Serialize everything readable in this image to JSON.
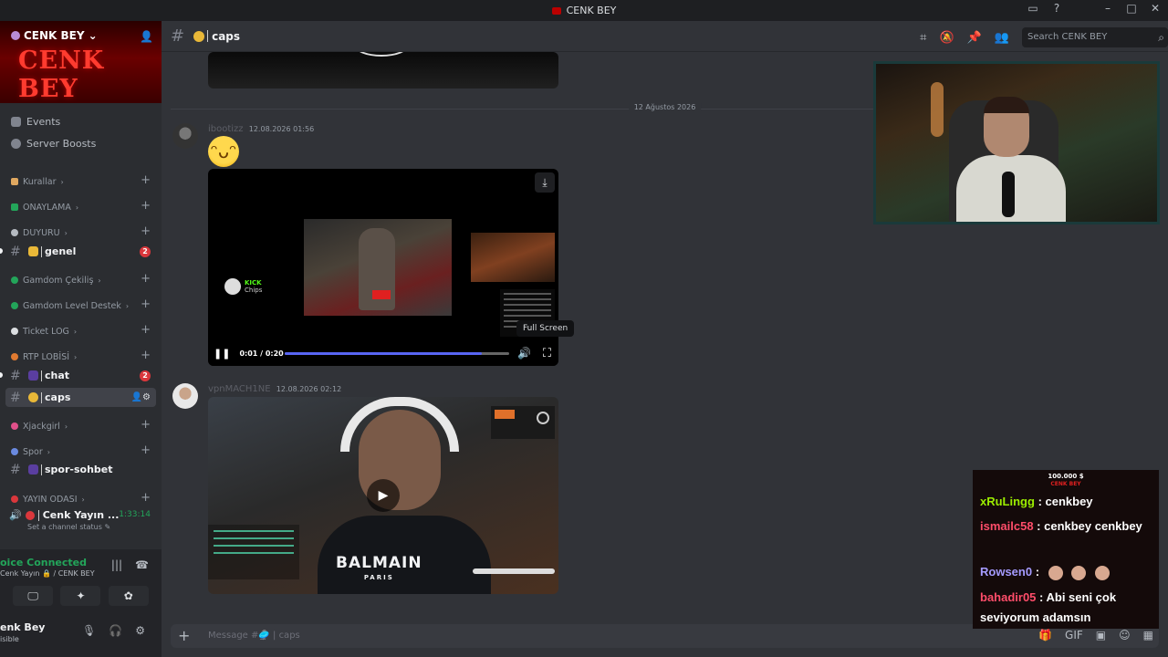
{
  "window": {
    "title": "CENK BEY"
  },
  "server": {
    "name": "CENK BEY",
    "banner_text": "CENK BEY",
    "nav": [
      {
        "label": "Events"
      },
      {
        "label": "Server Boosts"
      }
    ]
  },
  "categories": [
    {
      "label": "Kurallar"
    },
    {
      "label": "ONAYLAMA"
    },
    {
      "label": "DUYURU"
    },
    {
      "label": "Gamdom Çekiliş"
    },
    {
      "label": "Gamdom Level Destek"
    },
    {
      "label": "Ticket LOG"
    },
    {
      "label": "RTP LOBİSİ"
    },
    {
      "label": "Xjackgirl"
    },
    {
      "label": "Spor"
    },
    {
      "label": "YAYIN ODASI"
    }
  ],
  "channels": [
    {
      "name": "genel",
      "badge": "2"
    },
    {
      "name": "chat",
      "badge": "2"
    },
    {
      "name": "caps"
    },
    {
      "name": "spor-sohbet"
    }
  ],
  "voice_channel": {
    "name": "Cenk Yayın ...",
    "time": "1:33:14",
    "status": "Set a channel status"
  },
  "user_panel": {
    "voice_status": "oice Connected",
    "voice_sub": "Cenk Yayın 🔒 / CENK BEY",
    "username": "enk Bey",
    "user_status": "isible"
  },
  "header": {
    "channel": "caps",
    "search_placeholder": "Search CENK BEY"
  },
  "messages": {
    "date_divider": "12 Ağustos 2026",
    "msg1": {
      "author": "ibootizz",
      "timestamp": "12.08.2026 01:56"
    },
    "msg2": {
      "author": "vpnMACH1NE",
      "timestamp": "12.08.2026 02:12"
    }
  },
  "video_player": {
    "time": "0:01 / 0:20",
    "progress": 0.88,
    "tooltip": "Full Screen",
    "kick_label": "KICK",
    "kick_sub": "Chips"
  },
  "video2": {
    "shirt_text": "BALMAIN",
    "shirt_sub": "PARIS"
  },
  "composer": {
    "placeholder": "Message #🥏 | caps"
  },
  "overlay_chat": {
    "title": "100.000 $",
    "subtitle": "CENK BEY",
    "messages": [
      {
        "user": "xRuLingg",
        "text": ": cenkbey"
      },
      {
        "user": "ismailc58",
        "text": ": cenkbey cenkbey"
      },
      {
        "user": "Rowsen0",
        "text": ":"
      },
      {
        "user": "bahadir05",
        "text": ": Abi seni çok seviyorum adamsın"
      }
    ]
  },
  "colors": {
    "accent": "#5865f2",
    "online": "#23a55a",
    "danger": "#da373c"
  }
}
